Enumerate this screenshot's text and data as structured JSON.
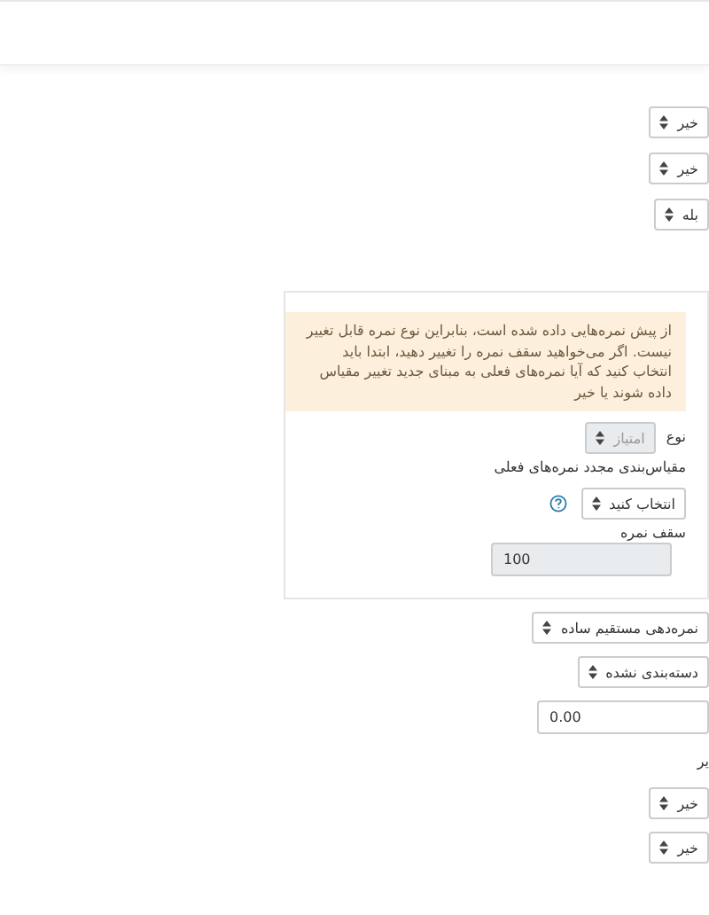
{
  "top_selects": [
    {
      "value": "خیر"
    },
    {
      "value": "خیر"
    },
    {
      "value": "بله"
    }
  ],
  "grade_panel": {
    "alert": "از پیش نمره‌هایی داده شده است، بنابراین نوع نمره قابل تغییر نیست. اگر می‌خواهید سقف نمره را تغییر دهید، ابتدا باید انتخاب کنید که آیا نمره‌های فعلی به مبنای جدید تغییر مقیاس داده شوند یا خیر",
    "type": {
      "label": "نوع",
      "value": "امتیاز",
      "disabled": true
    },
    "rescale": {
      "label": "مقیاس‌بندی مجدد نمره‌های فعلی",
      "value": "انتخاب کنید"
    },
    "max_grade": {
      "label": "سقف نمره",
      "value": "100",
      "disabled": true
    }
  },
  "fields": [
    {
      "kind": "select",
      "value": "نمره‌دهی مستقیم ساده"
    },
    {
      "kind": "select",
      "value": "دسته‌بندی نشده"
    },
    {
      "kind": "input",
      "value": "0.00"
    },
    {
      "kind": "label",
      "text": "یر"
    },
    {
      "kind": "select",
      "value": "خیر"
    },
    {
      "kind": "select",
      "value": "خیر"
    }
  ]
}
